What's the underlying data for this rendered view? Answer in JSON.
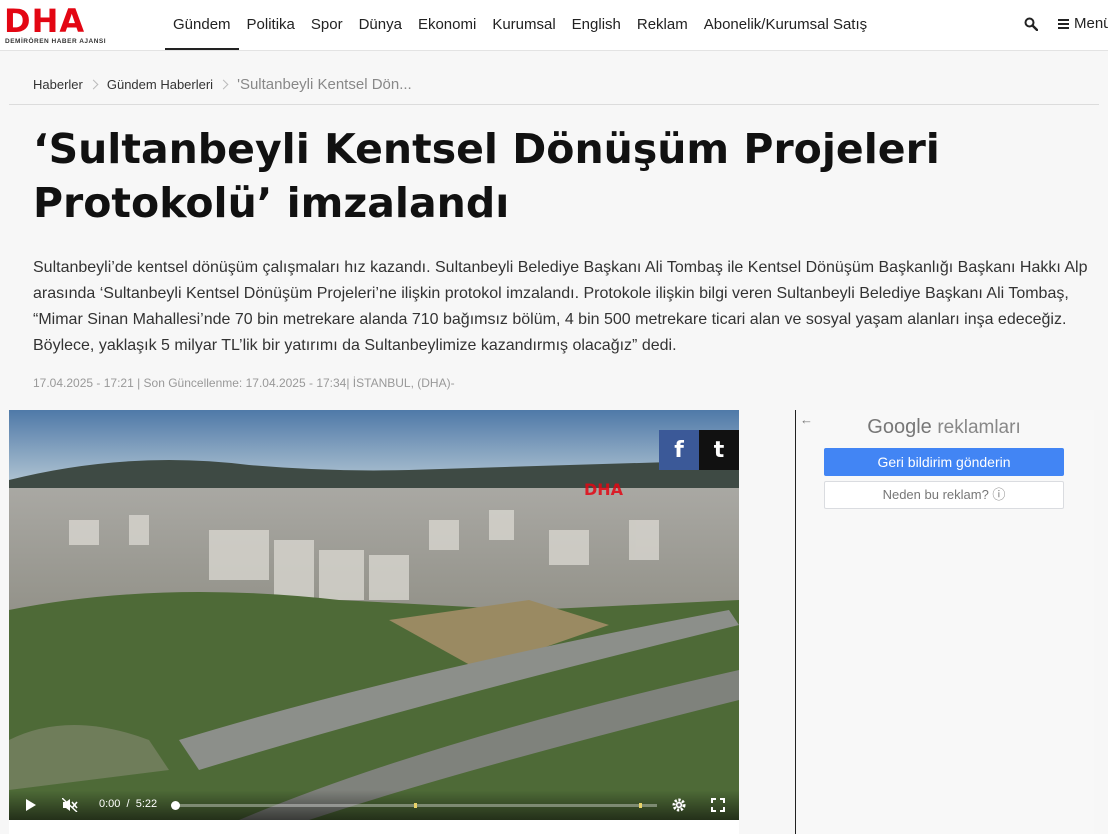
{
  "header": {
    "logo_text": "DHA",
    "logo_subtitle": "DEMİRÖREN HABER AJANSI",
    "nav": [
      "Gündem",
      "Politika",
      "Spor",
      "Dünya",
      "Ekonomi",
      "Kurumsal",
      "English",
      "Reklam",
      "Abonelik/Kurumsal Satış"
    ],
    "menu_label": "Menü"
  },
  "breadcrumb": {
    "items": [
      "Haberler",
      "Gündem Haberleri"
    ],
    "current": "'Sultanbeyli Kentsel Dön..."
  },
  "article": {
    "title": "‘Sultanbeyli Kentsel Dönüşüm Projeleri Protokolü’ imzalandı",
    "summary": "Sultanbeyli’de kentsel dönüşüm çalışmaları hız kazandı. Sultanbeyli Belediye Başkanı Ali Tombaş ile Kentsel Dönüşüm Başkanlığı Başkanı Hakkı Alp arasında ‘Sultanbeyli Kentsel Dönüşüm Projeleri’ne ilişkin protokol imzalandı. Protokole ilişkin bilgi veren Sultanbeyli Belediye Başkanı Ali Tombaş, “Mimar Sinan Mahallesi’nde 70 bin metrekare alanda 710 bağımsız bölüm, 4 bin 500 metrekare ticari alan ve sosyal yaşam alanları inşa edeceğiz. Böylece, yaklaşık 5 milyar TL’lik bir yatırımı da Sultanbeylimize kazandırmış olacağız” dedi.",
    "meta": "17.04.2025 - 17:21 | Son Güncellenme: 17.04.2025 - 17:34| İSTANBUL, (DHA)-"
  },
  "video": {
    "watermark": "DHA",
    "share_facebook": "f",
    "share_twitter": "t",
    "current_time": "0:00",
    "separator": "/",
    "duration": "5:22",
    "progress": 0
  },
  "ad": {
    "back_icon": "←",
    "brand": "Google",
    "title_suffix": "reklamları",
    "feedback_button": "Geri bildirim gönderin",
    "why_button": "Neden bu reklam? ⓘ"
  }
}
